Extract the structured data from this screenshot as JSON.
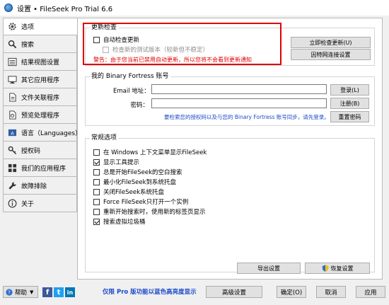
{
  "window": {
    "title": "设置 • FileSeek Pro Trial 6.6"
  },
  "sidebar": {
    "items": [
      {
        "label": "选项"
      },
      {
        "label": "搜索"
      },
      {
        "label": "结果视图设置"
      },
      {
        "label": "其它应用程序"
      },
      {
        "label": "文件关联程序"
      },
      {
        "label": "预览处理程序"
      },
      {
        "label": "语言（Languages）"
      },
      {
        "label": "授权码"
      },
      {
        "label": "我们的应用程序"
      },
      {
        "label": "故障排除"
      },
      {
        "label": "关于"
      }
    ]
  },
  "updates": {
    "title": "更新检查",
    "auto_check": {
      "label": "自动检查更新",
      "checked": false
    },
    "beta": {
      "label": "检查新的测试版本（较新但不稳定）",
      "checked": false,
      "disabled": true
    },
    "warning": "警告：由于您当前已禁用自动更新，所以您将不会看到更新通知",
    "check_now_button": "立即检查更新(U)",
    "proxy_button": "因特网连接设置"
  },
  "account": {
    "title": "我的 Binary Fortress 账号",
    "email_label": "Email 地址：",
    "email_value": "",
    "password_label": "密码：",
    "password_value": "",
    "login_button": "登录(L)",
    "register_button": "注册(B)",
    "reset_button": "重置密码",
    "link": "要检索您的授权码以及与您的 Binary Fortress 账号同步，请先登录。"
  },
  "general": {
    "title": "常规选项",
    "options": [
      {
        "label": "在 Windows 上下文菜单显示FileSeek",
        "checked": false
      },
      {
        "label": "显示工具提示",
        "checked": true
      },
      {
        "label": "总是开始FileSeek的空白搜索",
        "checked": false
      },
      {
        "label": "最小化FileSeek到系统托盘",
        "checked": false
      },
      {
        "label": "关闭FileSeek系统托盘",
        "checked": false
      },
      {
        "label": "Force FileSeek只打开一个实例",
        "checked": false
      },
      {
        "label": "重新开始搜索时，使用新的标签页显示",
        "checked": false
      },
      {
        "label": "搜索虚拟垃圾桶",
        "checked": true
      }
    ],
    "export_button": "导出设置",
    "restore_button": "恢复设置"
  },
  "footer": {
    "help_label": "帮助",
    "promo": "仅限 Pro 版功能以蓝色高亮度显示",
    "advanced_button": "高级设置",
    "ok_button": "确定(O)",
    "cancel_button": "取消",
    "apply_button": "应用"
  },
  "colors": {
    "accent": "#1a49c9",
    "warning": "#e00000",
    "facebook": "#3b5998",
    "twitter": "#1da1f2",
    "linkedin": "#0077b5"
  }
}
